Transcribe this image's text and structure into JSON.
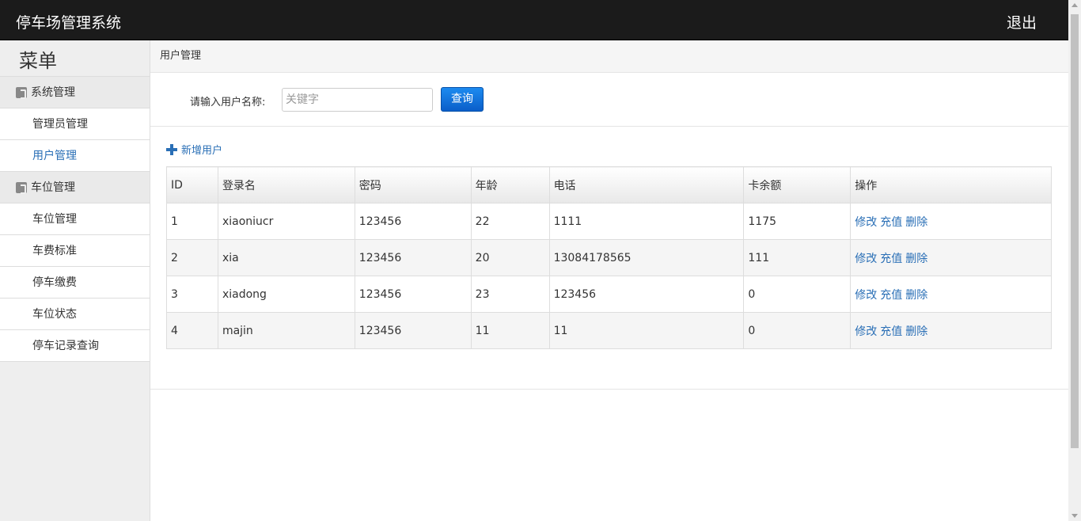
{
  "header": {
    "title": "停车场管理系统",
    "logout_label": "退出"
  },
  "sidebar": {
    "menu_title": "菜单",
    "groups": [
      {
        "label": "系统管理",
        "items": [
          "管理员管理",
          "用户管理"
        ]
      },
      {
        "label": "车位管理",
        "items": [
          "车位管理",
          "车费标准",
          "停车缴费",
          "车位状态",
          "停车记录查询"
        ]
      }
    ],
    "active_item": "用户管理"
  },
  "breadcrumb": "用户管理",
  "search": {
    "label": "请输入用户名称:",
    "placeholder": "关键字",
    "value": "",
    "button_label": "查询"
  },
  "add_user_label": "新增用户",
  "table": {
    "columns": [
      "ID",
      "登录名",
      "密码",
      "年龄",
      "电话",
      "卡余额",
      "操作"
    ],
    "rows": [
      [
        "1",
        "xiaoniucr",
        "123456",
        "22",
        "1111",
        "1175"
      ],
      [
        "2",
        "xia",
        "123456",
        "20",
        "13084178565",
        "111"
      ],
      [
        "3",
        "xiadong",
        "123456",
        "23",
        "123456",
        "0"
      ],
      [
        "4",
        "majin",
        "123456",
        "11",
        "11",
        "0"
      ]
    ],
    "actions": [
      "修改",
      "充值",
      "删除"
    ]
  },
  "colors": {
    "topbar": "#1b1b1b",
    "link": "#2a6fb6",
    "button": "#0a5ec9"
  }
}
